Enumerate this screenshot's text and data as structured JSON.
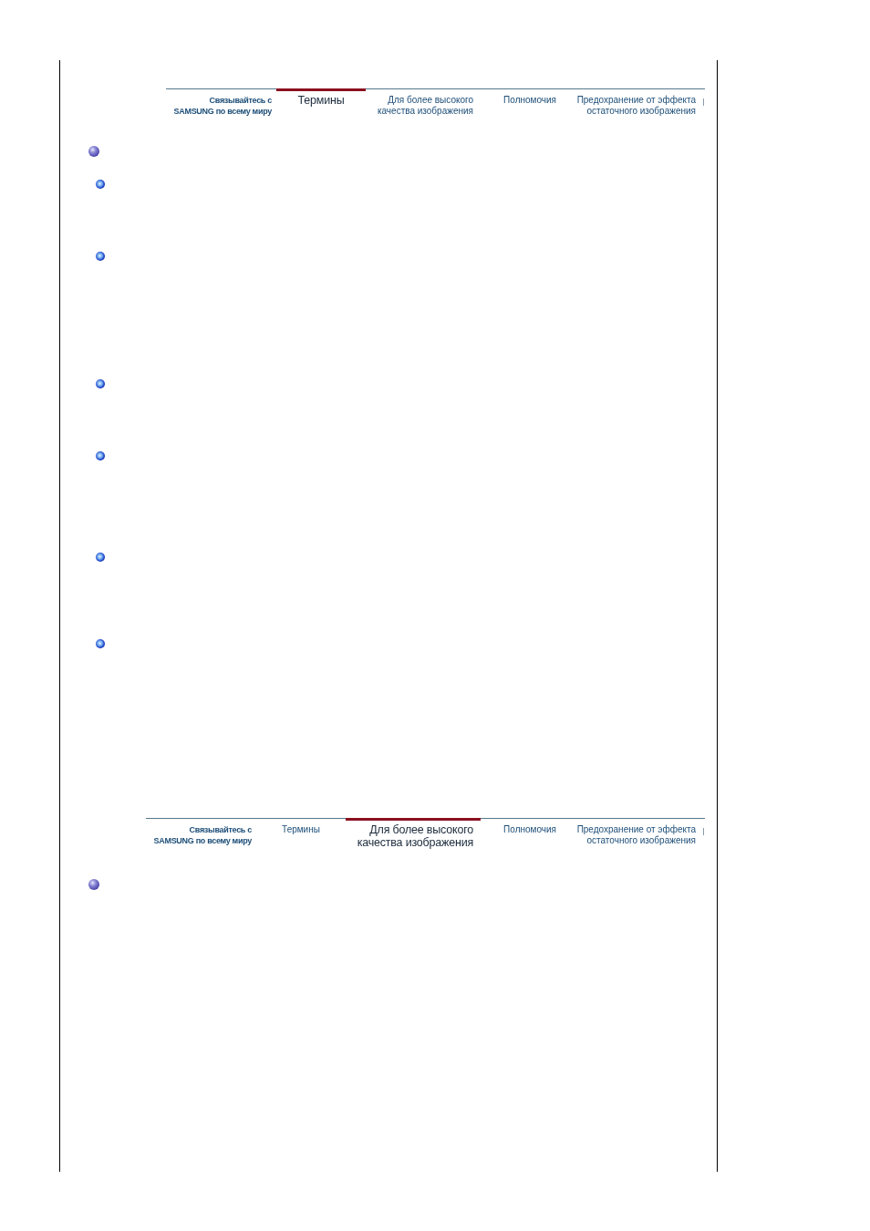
{
  "sections": [
    {
      "tabs": [
        {
          "label_lines": [
            "Связывайтесь с",
            "SAMSUNG по всему миру"
          ],
          "selected": false
        },
        {
          "label_lines": [
            "Термины"
          ],
          "selected": true
        },
        {
          "label_lines": [
            "Для более высокого",
            "качества изображения"
          ],
          "selected": false
        },
        {
          "label_lines": [
            "Полномочия"
          ],
          "selected": false
        },
        {
          "label_lines": [
            "Предохранение от эффекта",
            "остаточного изображения"
          ],
          "selected": false
        }
      ],
      "bullets": [
        {
          "kind": "heading"
        },
        {
          "kind": "item"
        },
        {
          "kind": "item"
        },
        {
          "kind": "item"
        },
        {
          "kind": "item"
        },
        {
          "kind": "item"
        },
        {
          "kind": "item"
        }
      ]
    },
    {
      "tabs": [
        {
          "label_lines": [
            "Связывайтесь с",
            "SAMSUNG по всему миру"
          ],
          "selected": false
        },
        {
          "label_lines": [
            "Термины"
          ],
          "selected": false
        },
        {
          "label_lines": [
            "Для более высокого",
            "качества изображения"
          ],
          "selected": true
        },
        {
          "label_lines": [
            "Полномочия"
          ],
          "selected": false
        },
        {
          "label_lines": [
            "Предохранение от эффекта",
            "остаточного изображения"
          ],
          "selected": false
        }
      ],
      "bullets": [
        {
          "kind": "heading"
        }
      ]
    }
  ]
}
